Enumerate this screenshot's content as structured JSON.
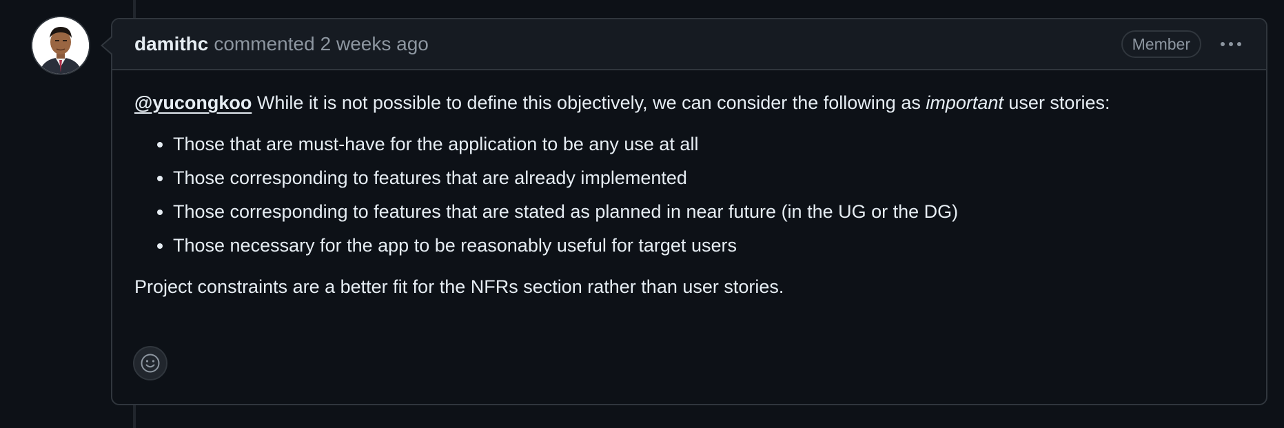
{
  "comment": {
    "author": "damithc",
    "action": "commented",
    "timestamp": "2 weeks ago",
    "role_badge": "Member",
    "menu_icon": "kebab-horizontal-icon",
    "mention": "@yucongkoo",
    "intro_text": " While it is not possible to define this objectively, we can consider the following as ",
    "intro_emphasis": "important",
    "intro_tail": " user stories:",
    "list_items": [
      "Those that are must-have for the application to be any use at all",
      "Those corresponding to features that are already implemented",
      "Those corresponding to features that are stated as planned in near future (in the UG or the DG)",
      "Those necessary for the app to be reasonably useful for target users"
    ],
    "closing_text": "Project constraints are a better fit for the NFRs section rather than user stories.",
    "reaction_icon": "smiley-icon"
  },
  "colors": {
    "background": "#0d1117",
    "header_background": "#161b22",
    "border": "#30363d",
    "text": "#e6edf3",
    "muted": "#8d96a0"
  }
}
